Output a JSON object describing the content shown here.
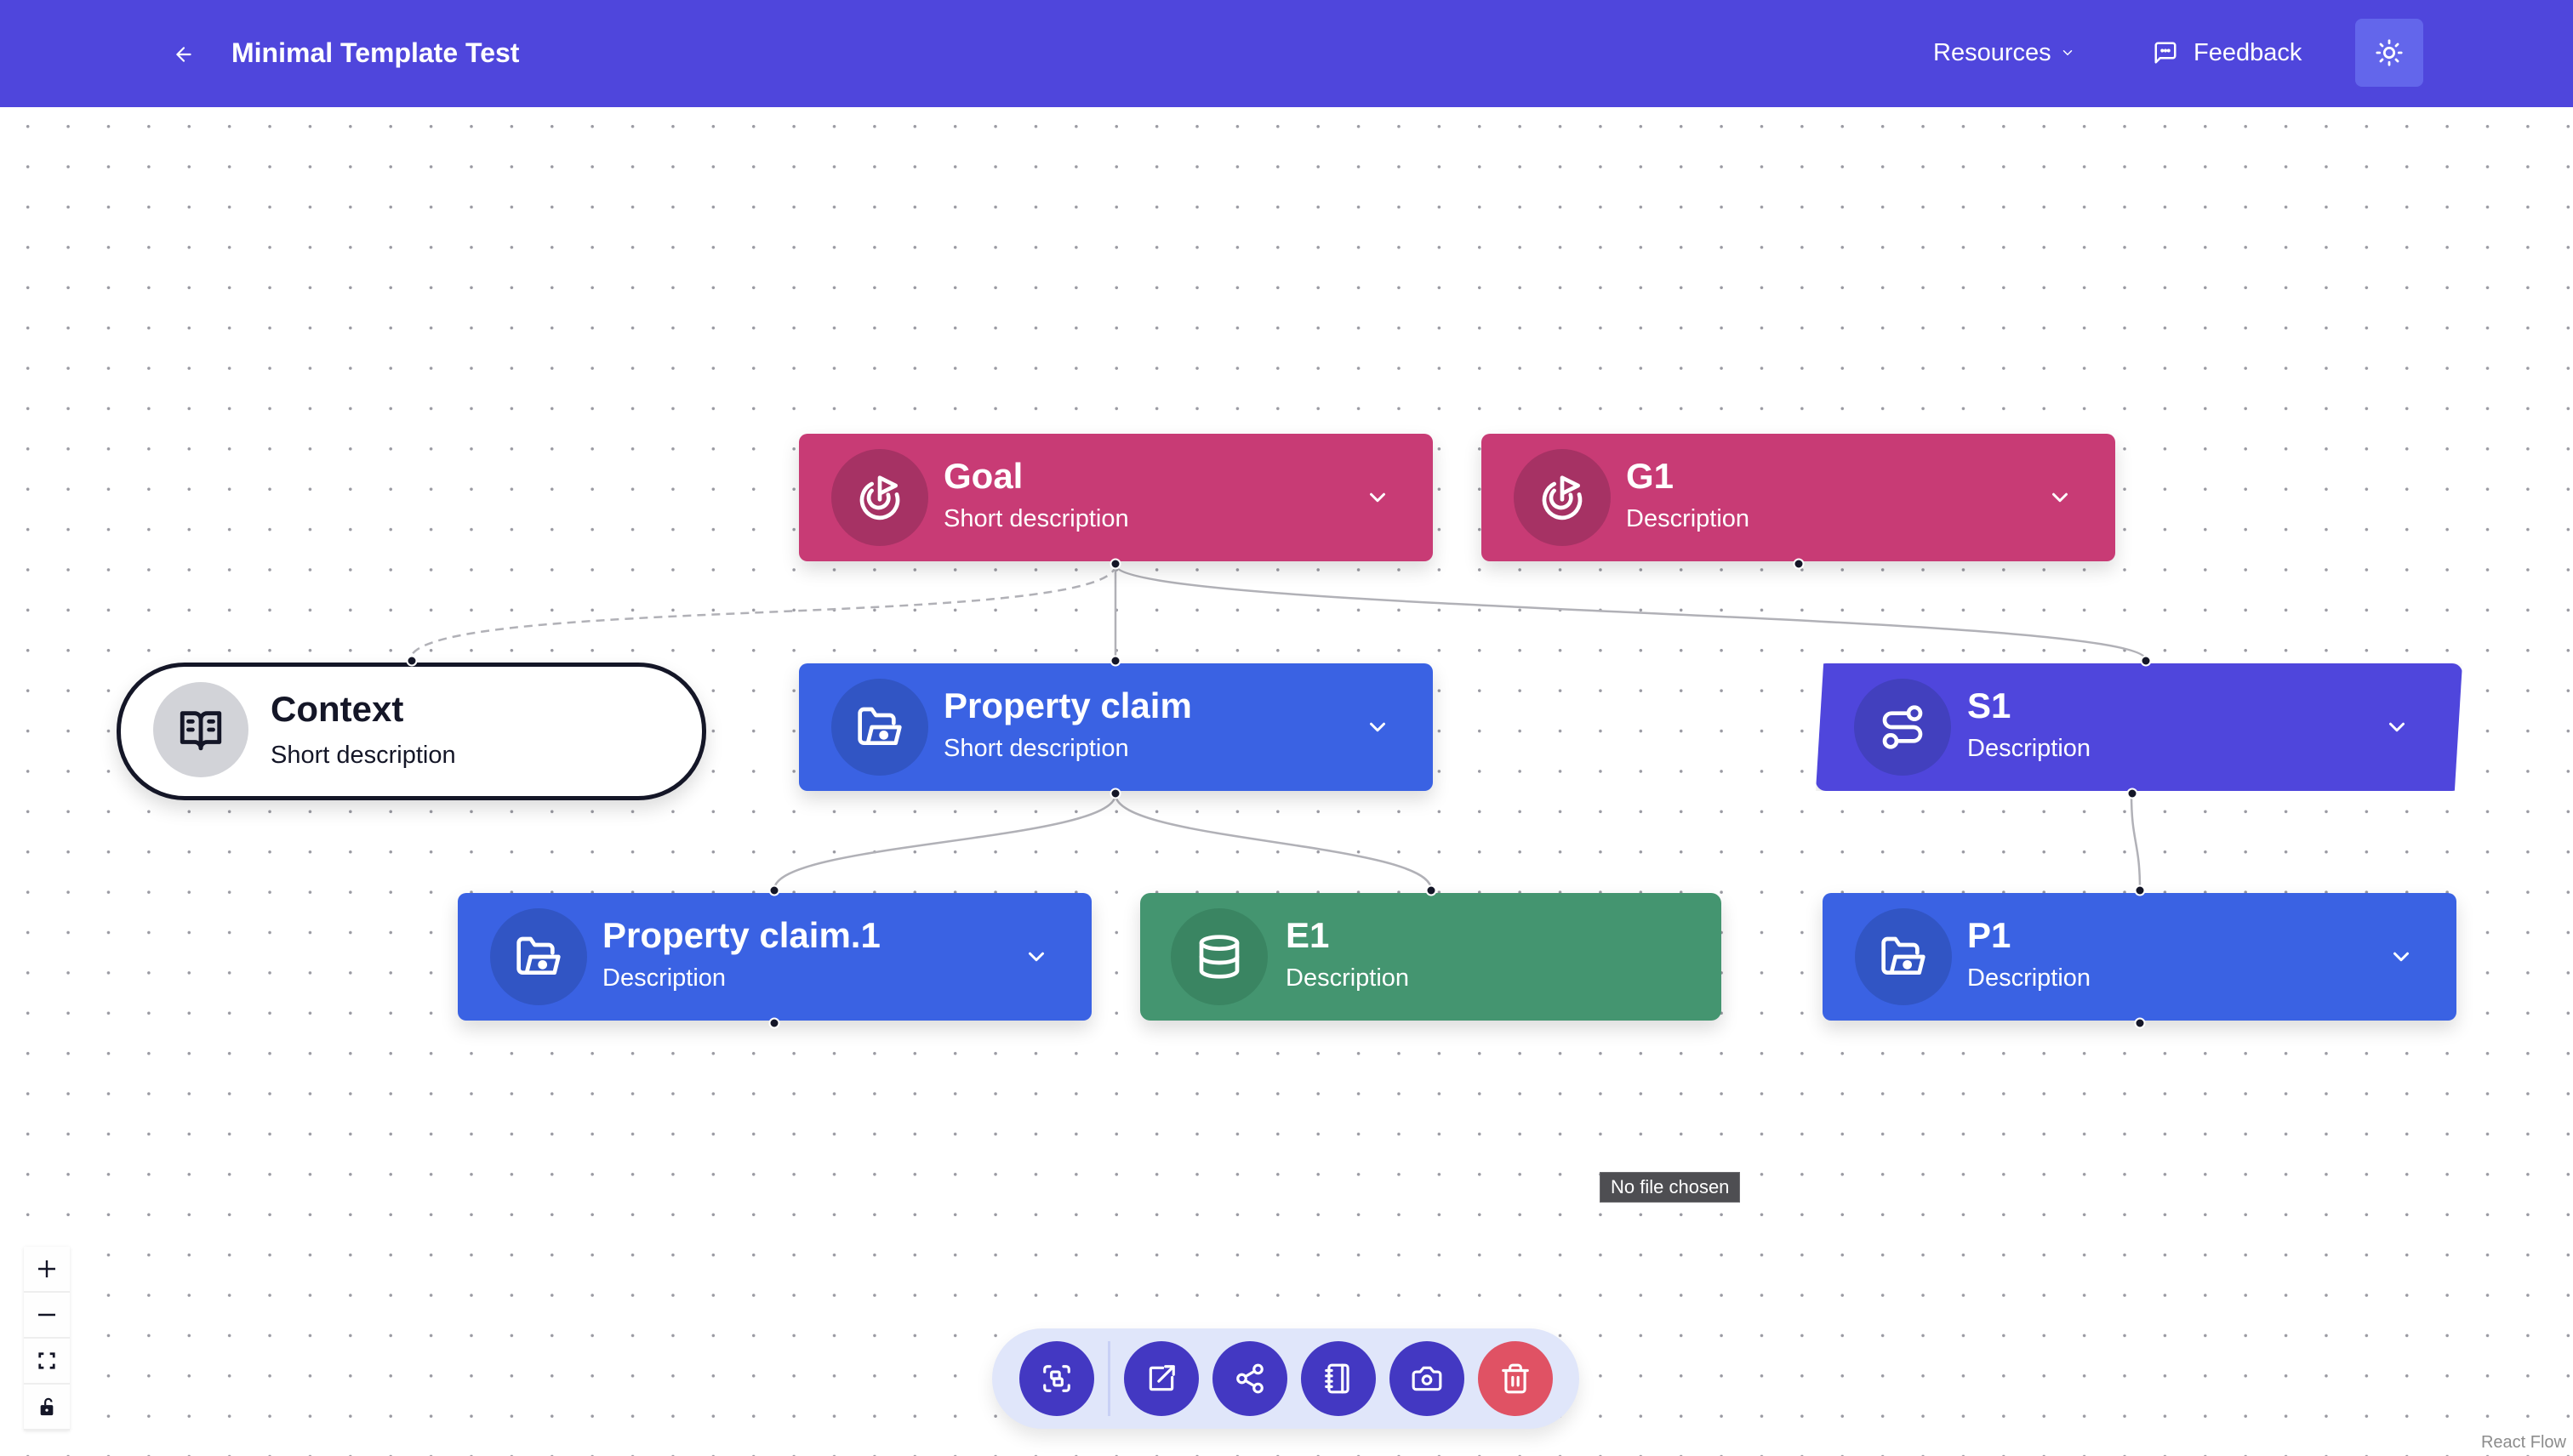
{
  "header": {
    "back_icon": "arrow-left-icon",
    "title": "Minimal Template Test",
    "resources_label": "Resources",
    "resources_icon": "chevron-down-icon",
    "feedback_label": "Feedback",
    "feedback_icon": "message-square-icon",
    "theme_icon": "sun-icon"
  },
  "colors": {
    "brand": "#4f46dc",
    "goal": "#c83b75",
    "claim": "#3a62e3",
    "strategy": "#4f46dc",
    "evidence": "#449570",
    "context_border": "#141627",
    "danger": "#e05264"
  },
  "nodes": [
    {
      "id": "goal",
      "type": "goal",
      "title": "Goal",
      "description": "Short description",
      "icon": "goal-target-icon",
      "expandable": true
    },
    {
      "id": "g1",
      "type": "goal",
      "title": "G1",
      "description": "Description",
      "icon": "goal-target-icon",
      "expandable": true
    },
    {
      "id": "context",
      "type": "context",
      "title": "Context",
      "description": "Short description",
      "icon": "book-open-icon",
      "expandable": false
    },
    {
      "id": "property-claim",
      "type": "claim",
      "title": "Property claim",
      "description": "Short description",
      "icon": "folder-open-icon",
      "expandable": true
    },
    {
      "id": "s1",
      "type": "strategy",
      "title": "S1",
      "description": "Description",
      "icon": "route-icon",
      "expandable": true
    },
    {
      "id": "property-claim-1",
      "type": "claim",
      "title": "Property claim.1",
      "description": "Description",
      "icon": "folder-open-icon",
      "expandable": true
    },
    {
      "id": "e1",
      "type": "evidence",
      "title": "E1",
      "description": "Description",
      "icon": "database-icon",
      "expandable": false
    },
    {
      "id": "p1",
      "type": "claim",
      "title": "P1",
      "description": "Description",
      "icon": "folder-open-icon",
      "expandable": true
    }
  ],
  "edges": [
    {
      "from": "Goal",
      "to": "Context",
      "style": "dashed"
    },
    {
      "from": "Goal",
      "to": "Property claim",
      "style": "solid"
    },
    {
      "from": "Goal",
      "to": "S1",
      "style": "solid"
    },
    {
      "from": "Property claim",
      "to": "Property claim.1",
      "style": "solid"
    },
    {
      "from": "Property claim",
      "to": "E1",
      "style": "solid"
    },
    {
      "from": "S1",
      "to": "P1",
      "style": "solid"
    }
  ],
  "controls": {
    "zoom_in": "plus-icon",
    "zoom_out": "minus-icon",
    "fit_view": "fit-view-icon",
    "interactivity": "unlock-icon"
  },
  "toolbar": {
    "buttons": [
      {
        "name": "focus",
        "icon": "scan-focus-icon"
      },
      {
        "name": "export",
        "icon": "external-link-icon"
      },
      {
        "name": "share",
        "icon": "share-icon"
      },
      {
        "name": "notes",
        "icon": "notebook-icon"
      },
      {
        "name": "screenshot",
        "icon": "camera-icon"
      },
      {
        "name": "delete",
        "icon": "trash-icon"
      }
    ]
  },
  "file_tooltip": "No file chosen",
  "attribution": "React Flow"
}
